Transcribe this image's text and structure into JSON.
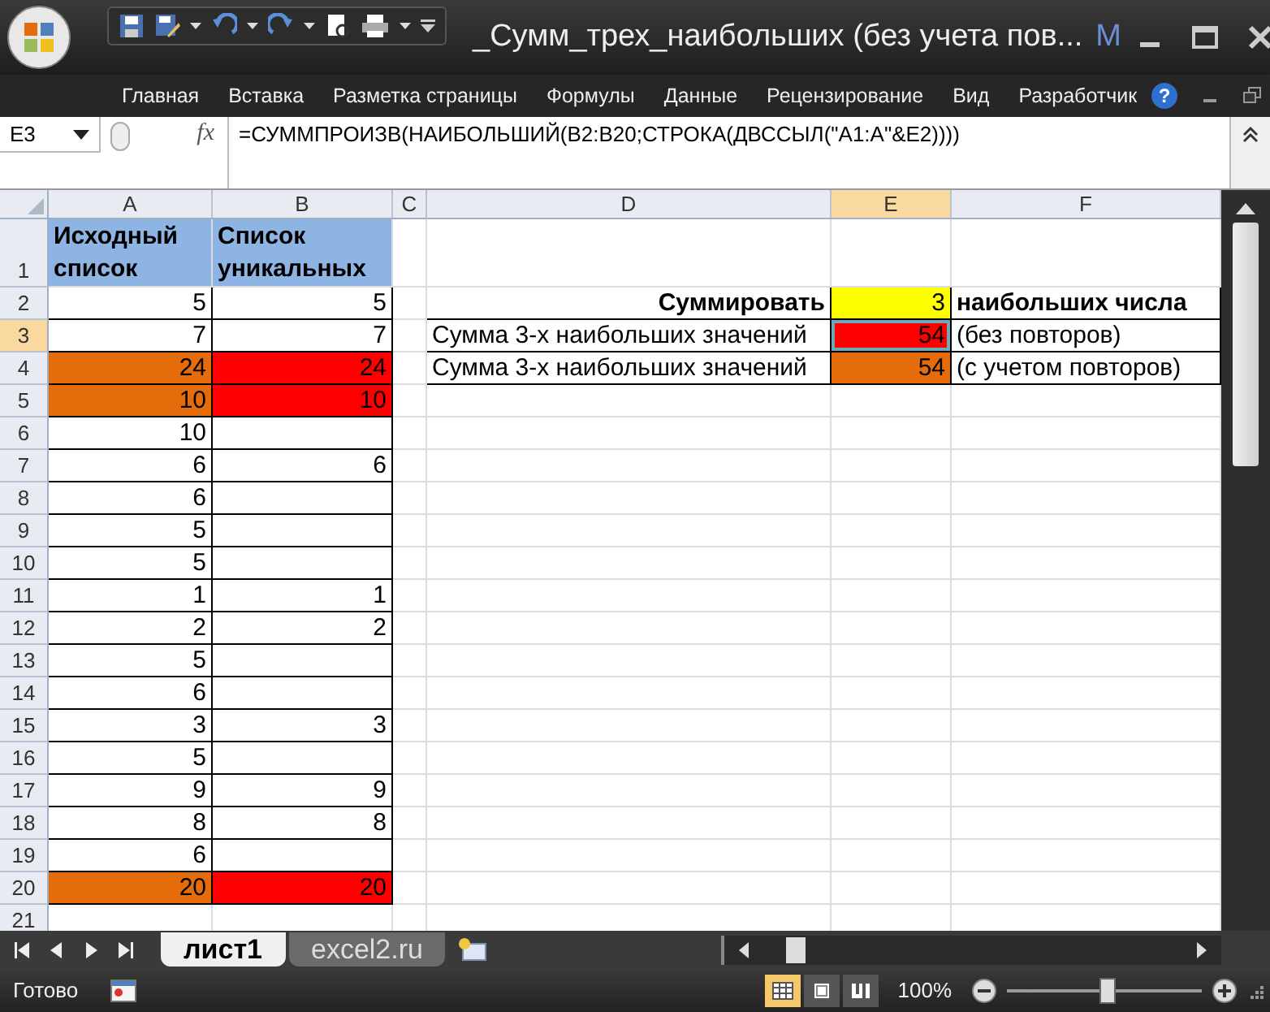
{
  "window": {
    "title": "_Сумм_трех_наибольших (без учета пов...",
    "title_cut": "M"
  },
  "ribbon_tabs": [
    {
      "label": "Главная",
      "selected": false
    },
    {
      "label": "Вставка",
      "selected": false
    },
    {
      "label": "Разметка страницы",
      "selected": false
    },
    {
      "label": "Формулы",
      "selected": false
    },
    {
      "label": "Данные",
      "selected": false
    },
    {
      "label": "Рецензирование",
      "selected": false
    },
    {
      "label": "Вид",
      "selected": false
    },
    {
      "label": "Разработчик",
      "selected": false
    }
  ],
  "help": "?",
  "formula_bar": {
    "name_box": "E3",
    "fx_label": "fx",
    "formula": "=СУММПРОИЗВ(НАИБОЛЬШИЙ(B2:B20;СТРОКА(ДВССЫЛ(\"A1:A\"&E2))))"
  },
  "columns": [
    {
      "label": "A",
      "selected": false
    },
    {
      "label": "B",
      "selected": false
    },
    {
      "label": "C",
      "selected": false
    },
    {
      "label": "D",
      "selected": false
    },
    {
      "label": "E",
      "selected": true
    },
    {
      "label": "F",
      "selected": false
    }
  ],
  "rows": [
    {
      "n": "1",
      "selected": false,
      "cells": [
        {
          "text": "Исходный список",
          "kind": "header",
          "color": "#8db4e2"
        },
        {
          "text": "Список уникальных",
          "kind": "header",
          "color": "#8db4e2"
        },
        {},
        {},
        {},
        {}
      ]
    },
    {
      "n": "2",
      "selected": false,
      "cells": [
        {
          "text": "5",
          "kind": "number",
          "bordered": true
        },
        {
          "text": "5",
          "kind": "number",
          "bordered": true
        },
        {},
        {
          "text": "Суммировать",
          "kind": "label",
          "bordered": true
        },
        {
          "text": "3",
          "kind": "highlight",
          "bordered": true,
          "color": "#ffff00"
        },
        {
          "text": "наибольших числа",
          "kind": "bold",
          "bordered": true
        }
      ]
    },
    {
      "n": "3",
      "selected": true,
      "cells": [
        {
          "text": "7",
          "kind": "number",
          "bordered": true
        },
        {
          "text": "7",
          "kind": "number",
          "bordered": true
        },
        {},
        {
          "text": "Сумма 3-х наибольших значений",
          "kind": "text",
          "bordered": true
        },
        {
          "text": "54",
          "kind": "number",
          "bordered": true,
          "color": "#ff0000"
        },
        {
          "text": "(без повторов)",
          "kind": "text",
          "bordered": true
        }
      ]
    },
    {
      "n": "4",
      "selected": false,
      "cells": [
        {
          "text": "24",
          "kind": "number",
          "bordered": true,
          "color": "#e46c0a"
        },
        {
          "text": "24",
          "kind": "number",
          "bordered": true,
          "color": "#ff0000"
        },
        {},
        {
          "text": "Сумма 3-х наибольших значений",
          "kind": "text",
          "bordered": true
        },
        {
          "text": "54",
          "kind": "number",
          "bordered": true,
          "color": "#e46c0a"
        },
        {
          "text": "(с учетом повторов)",
          "kind": "text",
          "bordered": true
        }
      ]
    },
    {
      "n": "5",
      "selected": false,
      "cells": [
        {
          "text": "10",
          "kind": "number",
          "bordered": true,
          "color": "#e46c0a"
        },
        {
          "text": "10",
          "kind": "number",
          "bordered": true,
          "color": "#ff0000"
        },
        {},
        {},
        {},
        {}
      ]
    },
    {
      "n": "6",
      "selected": false,
      "cells": [
        {
          "text": "10",
          "kind": "number",
          "bordered": true
        },
        {
          "bordered": true
        },
        {},
        {},
        {},
        {}
      ]
    },
    {
      "n": "7",
      "selected": false,
      "cells": [
        {
          "text": "6",
          "kind": "number",
          "bordered": true
        },
        {
          "text": "6",
          "kind": "number",
          "bordered": true
        },
        {},
        {},
        {},
        {}
      ]
    },
    {
      "n": "8",
      "selected": false,
      "cells": [
        {
          "text": "6",
          "kind": "number",
          "bordered": true
        },
        {
          "bordered": true
        },
        {},
        {},
        {},
        {}
      ]
    },
    {
      "n": "9",
      "selected": false,
      "cells": [
        {
          "text": "5",
          "kind": "number",
          "bordered": true
        },
        {
          "bordered": true
        },
        {},
        {},
        {},
        {}
      ]
    },
    {
      "n": "10",
      "selected": false,
      "cells": [
        {
          "text": "5",
          "kind": "number",
          "bordered": true
        },
        {
          "bordered": true
        },
        {},
        {},
        {},
        {}
      ]
    },
    {
      "n": "11",
      "selected": false,
      "cells": [
        {
          "text": "1",
          "kind": "number",
          "bordered": true
        },
        {
          "text": "1",
          "kind": "number",
          "bordered": true
        },
        {},
        {},
        {},
        {}
      ]
    },
    {
      "n": "12",
      "selected": false,
      "cells": [
        {
          "text": "2",
          "kind": "number",
          "bordered": true
        },
        {
          "text": "2",
          "kind": "number",
          "bordered": true
        },
        {},
        {},
        {},
        {}
      ]
    },
    {
      "n": "13",
      "selected": false,
      "cells": [
        {
          "text": "5",
          "kind": "number",
          "bordered": true
        },
        {
          "bordered": true
        },
        {},
        {},
        {},
        {}
      ]
    },
    {
      "n": "14",
      "selected": false,
      "cells": [
        {
          "text": "6",
          "kind": "number",
          "bordered": true
        },
        {
          "bordered": true
        },
        {},
        {},
        {},
        {}
      ]
    },
    {
      "n": "15",
      "selected": false,
      "cells": [
        {
          "text": "3",
          "kind": "number",
          "bordered": true
        },
        {
          "text": "3",
          "kind": "number",
          "bordered": true
        },
        {},
        {},
        {},
        {}
      ]
    },
    {
      "n": "16",
      "selected": false,
      "cells": [
        {
          "text": "5",
          "kind": "number",
          "bordered": true
        },
        {
          "bordered": true
        },
        {},
        {},
        {},
        {}
      ]
    },
    {
      "n": "17",
      "selected": false,
      "cells": [
        {
          "text": "9",
          "kind": "number",
          "bordered": true
        },
        {
          "text": "9",
          "kind": "number",
          "bordered": true
        },
        {},
        {},
        {},
        {}
      ]
    },
    {
      "n": "18",
      "selected": false,
      "cells": [
        {
          "text": "8",
          "kind": "number",
          "bordered": true
        },
        {
          "text": "8",
          "kind": "number",
          "bordered": true
        },
        {},
        {},
        {},
        {}
      ]
    },
    {
      "n": "19",
      "selected": false,
      "cells": [
        {
          "text": "6",
          "kind": "number",
          "bordered": true
        },
        {
          "bordered": true
        },
        {},
        {},
        {},
        {}
      ]
    },
    {
      "n": "20",
      "selected": false,
      "cells": [
        {
          "text": "20",
          "kind": "number",
          "bordered": true,
          "color": "#e46c0a"
        },
        {
          "text": "20",
          "kind": "number",
          "bordered": true,
          "color": "#ff0000"
        },
        {},
        {},
        {},
        {}
      ]
    },
    {
      "n": "21",
      "selected": false,
      "cells": [
        {},
        {},
        {},
        {},
        {},
        {}
      ]
    }
  ],
  "sheet_tabs": [
    {
      "label": "лист1",
      "selected": true
    },
    {
      "label": "excel2.ru",
      "selected": false
    }
  ],
  "status_bar": {
    "status": "Готово",
    "views": [
      {
        "kind": "normal",
        "selected": true
      },
      {
        "kind": "page-layout",
        "selected": false
      },
      {
        "kind": "page-break",
        "selected": false
      }
    ],
    "zoom": "100%",
    "zoom_level": {
      "level": 0.52
    }
  }
}
